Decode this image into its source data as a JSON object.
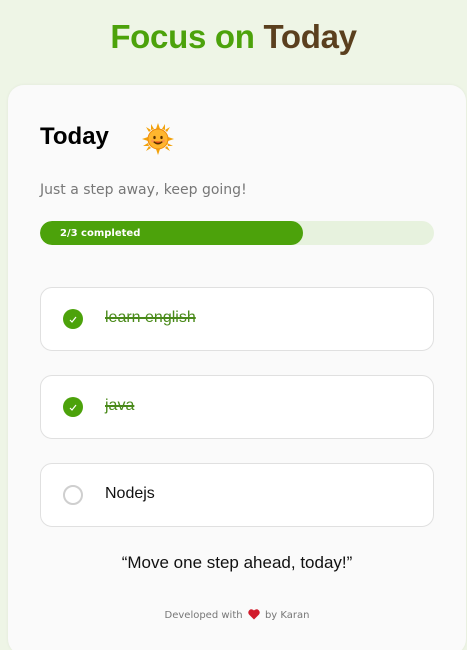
{
  "app_title": {
    "part1": "Focus on",
    "part2": "Today"
  },
  "header": {
    "title": "Today",
    "icon": "sun-icon",
    "subtitle": "Just a step away, keep going!"
  },
  "progress": {
    "label": "2/3 completed",
    "completed": 2,
    "total": 3
  },
  "tasks": [
    {
      "label": "learn english",
      "done": true
    },
    {
      "label": "java",
      "done": true
    },
    {
      "label": "Nodejs",
      "done": false
    }
  ],
  "quote": "“Move one step ahead, today!”",
  "footer": {
    "prefix": "Developed with",
    "icon": "heart-icon",
    "suffix": "by Karan"
  },
  "colors": {
    "accent": "#4ca20b",
    "brown": "#5a3f1e",
    "background": "#eef5e6",
    "heart": "#d11a2a"
  }
}
